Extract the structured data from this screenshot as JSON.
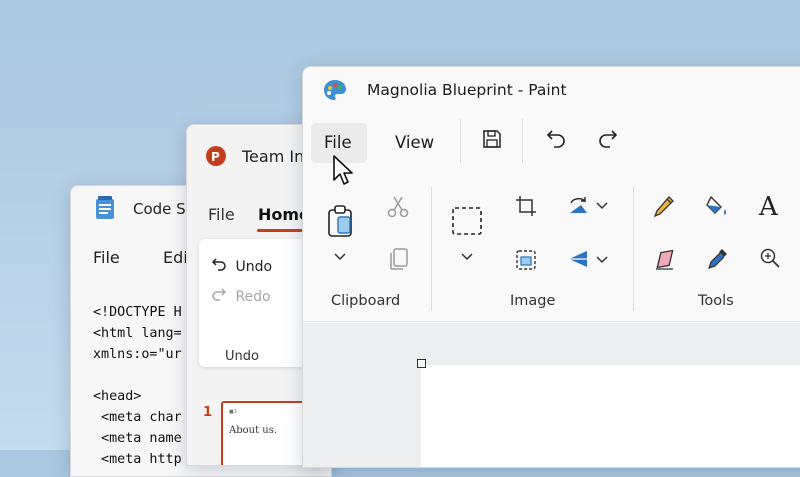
{
  "code_window": {
    "title": "Code Si",
    "menu": [
      "File",
      "Edi"
    ],
    "code_lines": [
      "<!DOCTYPE H",
      "<html lang=",
      "xmlns:o=\"ur",
      "",
      "<head>",
      " <meta char",
      " <meta name",
      " <meta http"
    ]
  },
  "ppt_window": {
    "title": "Team In",
    "tabs": [
      "File",
      "Home"
    ],
    "undo_label": "Undo",
    "redo_label": "Redo",
    "group_label": "Undo",
    "slide_number": "1",
    "slide_text_small": "■1",
    "slide_text": "About us."
  },
  "paint_window": {
    "title": "Magnolia Blueprint - Paint",
    "menu": {
      "file": "File",
      "view": "View"
    },
    "groups": {
      "clipboard": "Clipboard",
      "image": "Image",
      "tools": "Tools"
    },
    "icons": [
      "paint-palette-icon",
      "save-icon",
      "undo-icon",
      "redo-icon",
      "paste-icon",
      "scissors-icon",
      "copy-icon",
      "select-icon",
      "crop-icon",
      "rotate-icon",
      "resize-icon",
      "flip-icon",
      "pencil-icon",
      "fill-icon",
      "text-icon",
      "eraser-icon",
      "color-picker-icon",
      "magnifier-icon"
    ]
  },
  "colors": {
    "ppt_accent": "#c43e1c",
    "background": "#b8d2e8"
  }
}
